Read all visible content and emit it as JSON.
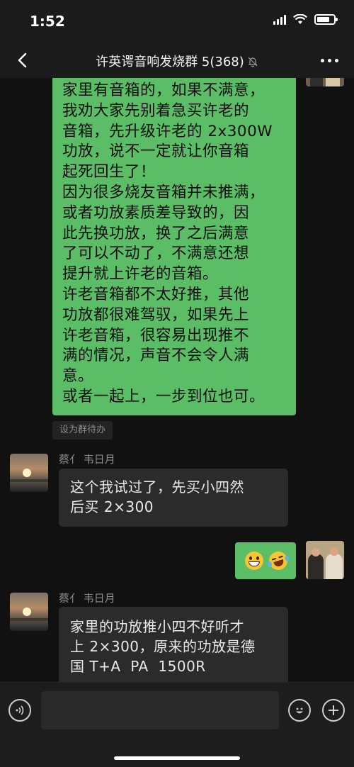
{
  "status_bar": {
    "time": "1:52"
  },
  "header": {
    "title": "许英谔音响发烧群 5(368)",
    "icons": [
      "back-chevron-icon",
      "mute-bell-icon",
      "more-dots-icon"
    ]
  },
  "messages": [
    {
      "side": "right",
      "text": "家里有音箱的，如果不满意，\n我劝大家先别着急买许老的\n音箱，先升级许老的 2x300W\n功放，说不一定就让你音箱\n起死回生了！\n因为很多烧友音箱并未推满，\n或者功放素质差导致的，因\n此先换功放，换了之后满意\n了可以不动了，不满意还想\n提升就上许老的音箱。\n许老音箱都不太好推，其他\n功放都很难驾驭，如果先上\n许老音箱，很容易出现推不\n满的情况，声音不会令人满\n意。\n或者一起上，一步到位也可。",
      "action_chip": "设为群待办"
    },
    {
      "side": "left",
      "sender": "蔡亻 韦日月",
      "text": "这个我试过了，先买小四然\n后买 2×300"
    },
    {
      "side": "right",
      "emoji": [
        "grinning-face-icon",
        "laughing-tears-face-icon"
      ]
    },
    {
      "side": "left",
      "sender": "蔡亻 韦日月",
      "text": "家里的功放推小四不好听才\n上 2×300，原来的功放是德\n国 T+A  PA  1500R"
    }
  ],
  "input_bar": {
    "placeholder": ""
  },
  "colors": {
    "my_bubble": "#5bbd66",
    "other_bubble": "#2b2b2b",
    "background": "#111111"
  }
}
